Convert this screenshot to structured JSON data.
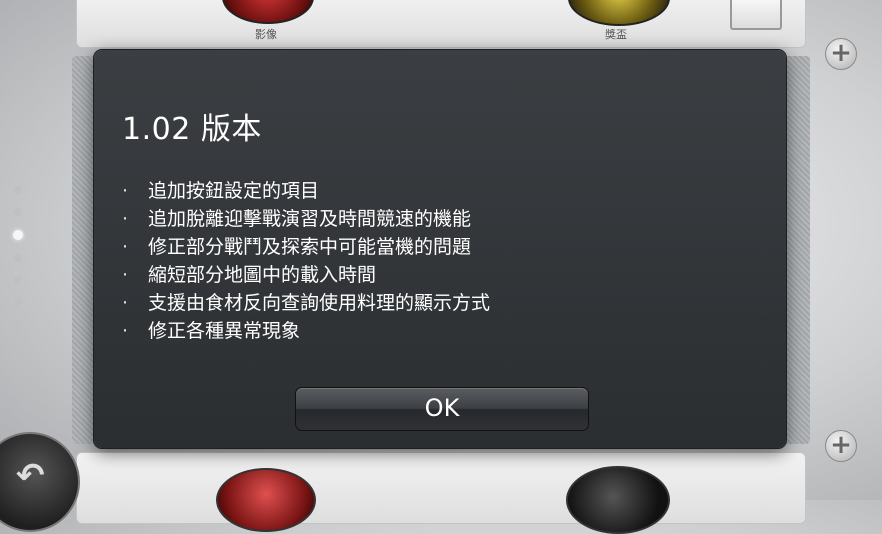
{
  "apps": {
    "top_left_label": "影像",
    "top_right_label": "獎盃"
  },
  "icons": {
    "add": "plus-icon",
    "back": "back-arrow-icon",
    "page_indicator": "page-dot-icon"
  },
  "plus_symbol": "+",
  "back_symbol": "↶",
  "dialog": {
    "title": "1.02 版本",
    "bullet": "·",
    "notes": [
      "追加按鈕設定的項目",
      "追加脫離迎擊戰演習及時間競速的機能",
      "修正部分戰鬥及探索中可能當機的問題",
      "縮短部分地圖中的載入時間",
      "支援由食材反向查詢使用料理的顯示方式",
      "修正各種異常現象"
    ],
    "ok_label": "OK"
  },
  "colors": {
    "dialog_bg": "#2f3235",
    "text": "#ffffff"
  }
}
